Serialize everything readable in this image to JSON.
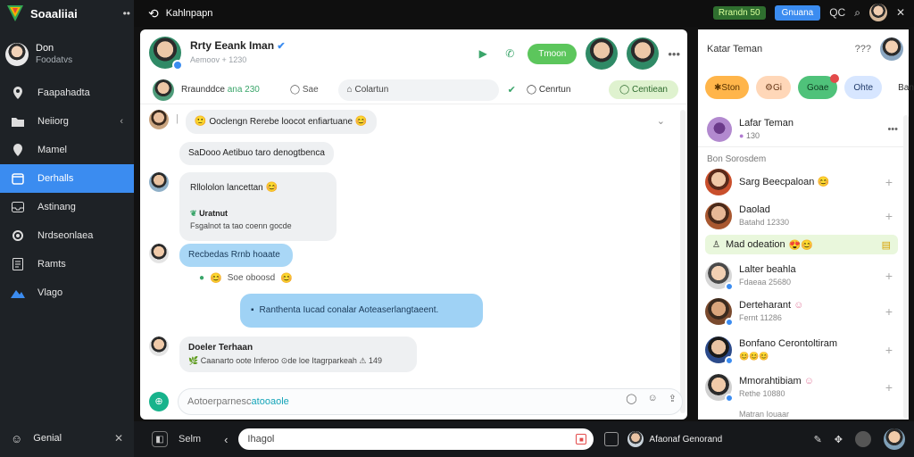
{
  "brand": {
    "name": "Soaaliiai",
    "menu_icon": "dots-icon"
  },
  "sidebar": {
    "user": {
      "title": "Don",
      "subtitle": "Foodatvs"
    },
    "items": [
      {
        "label": "Faapahadta",
        "icon": "location-icon"
      },
      {
        "label": "Neiiorg",
        "icon": "folder-icon"
      },
      {
        "label": "Mamel",
        "icon": "location-icon"
      },
      {
        "label": "Derhalls",
        "icon": "calendar-icon"
      },
      {
        "label": "Astinang",
        "icon": "inbox-icon"
      },
      {
        "label": "Nrdseonlaea",
        "icon": "settings-icon"
      },
      {
        "label": "Ramts",
        "icon": "document-icon"
      },
      {
        "label": "Vlago",
        "icon": "mountain-icon"
      }
    ],
    "bottom": {
      "label": "Genial"
    }
  },
  "topbar": {
    "title": "Kahlnpapn",
    "pill": "Rrandn 50",
    "button": "Gnuana",
    "icons": [
      "qc-icon",
      "search-icon",
      "avatar-icon",
      "close-icon"
    ]
  },
  "chat": {
    "header": {
      "name": "Rrty Eeank Iman",
      "subtitle": "Aemoov + 1230",
      "action": "Tmoon"
    },
    "subbar": {
      "name": "Rraunddce",
      "name_hl": "ana 230",
      "chip": "Sae",
      "search": "Colartun",
      "option": "Cenrtun",
      "pill": "Centiean"
    },
    "messages": [
      {
        "text": "Ooclengn Rerebe loocot enfiartuane"
      },
      {
        "text": "SaDooo Aetibuo taro denogtbenca"
      },
      {
        "text": "Rllololon lancettan",
        "sub_title": "Uratnut",
        "sub_text": "Fsgalnot ta tao coenn gocde"
      },
      {
        "text": "Recbedas Rrnb hoaate",
        "meta": "Soe oboosd"
      },
      {
        "text": "Ranthenta Iucad conalar Aoteaserlangtaeent."
      },
      {
        "title": "Doeler Terhaan",
        "text": "Caanarto oote Inferoo ⊙de loe Itagrparkeah",
        "badge": "149"
      }
    ],
    "composer": {
      "placeholder_a": "Aotoerparnesc",
      "placeholder_b": "atooaole"
    }
  },
  "panel": {
    "title": "Katar Teman",
    "dropdown": "???",
    "filters": [
      "Ston",
      "Gi",
      "Goae",
      "Ohte",
      "Ban"
    ],
    "top_item": {
      "name": "Lafar Teman",
      "sub": "130"
    },
    "section": "Bon Sorosdem",
    "contacts": [
      {
        "name": "Sarg Beecpaloan",
        "sub": "",
        "avatar_color": "#c94f2c"
      },
      {
        "name": "Daolad",
        "sub": "Batahd 12330",
        "avatar_color": "#a8572f"
      },
      {
        "name": "Mad odeation",
        "sub": "",
        "highlight": true,
        "avatar_color": "#b0b0b0"
      },
      {
        "name": "Lalter beahla",
        "sub": "Fdaeaa 25680",
        "avatar_color": "#c7c7c7"
      },
      {
        "name": "Derteharant",
        "sub": "Fernt 11286",
        "avatar_color": "#7a4a2e"
      },
      {
        "name": "Bonfano Cerontoltiram",
        "sub": "",
        "avatar_color": "#2b4a8a"
      },
      {
        "name": "Mmorahtibiam",
        "sub": "Rethe 10880",
        "avatar_color": "#cfcfcf"
      }
    ],
    "partial_last": "Matran Iouaar"
  },
  "bottombar": {
    "label": "Selm",
    "input": "Ihagol",
    "user": "Afaonaf Genorand"
  }
}
